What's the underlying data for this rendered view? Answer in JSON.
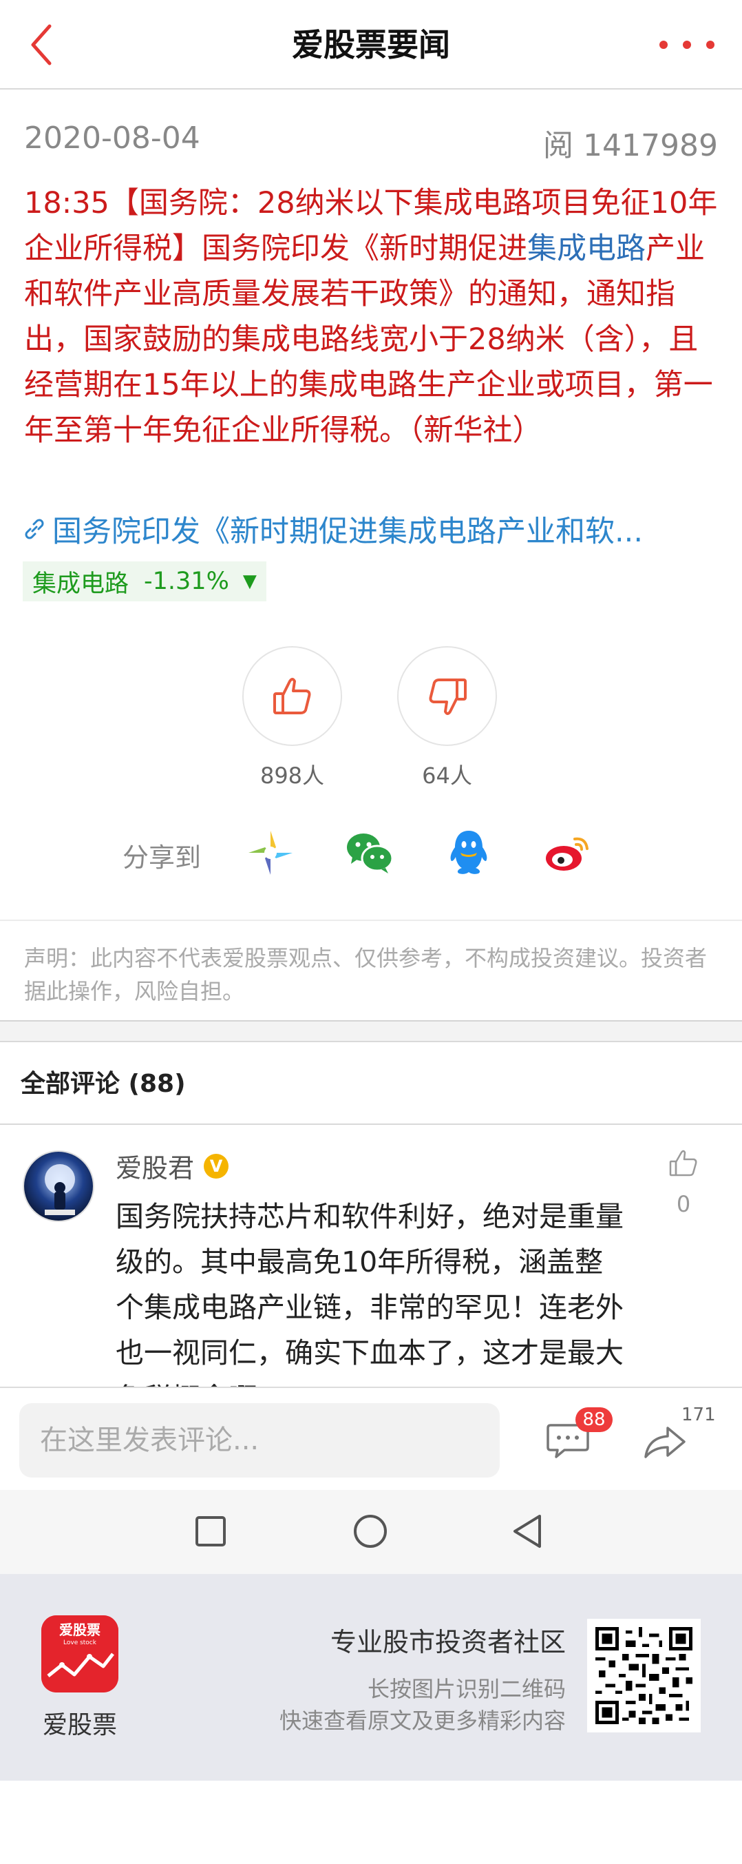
{
  "header": {
    "title": "爱股票要闻"
  },
  "meta": {
    "date": "2020-08-04",
    "reads": "阅 1417989"
  },
  "article": {
    "text_part1": "18:35【国务院：28纳米以下集成电路项目免征10年企业所得税】国务院印发《新时期促进",
    "highlight": "集成电路",
    "text_part2": "产业和软件产业高质量发展若干政策》的通知，通知指出，国家鼓励的集成电路线宽小于28纳米（含），且经营期在15年以上的集成电路生产企业或项目，第一年至第十年免征企业所得税。（新华社）"
  },
  "link": {
    "text": "国务院印发《新时期促进集成电路产业和软..."
  },
  "stock": {
    "name": "集成电路",
    "change": "-1.31%",
    "arrow": "▼",
    "color": "#1e9b1e"
  },
  "votes": {
    "up_count": "898人",
    "down_count": "64人"
  },
  "share": {
    "label": "分享到",
    "targets": [
      "moments-icon",
      "wechat-icon",
      "qq-icon",
      "weibo-icon"
    ]
  },
  "disclaimer": {
    "text": "声明：此内容不代表爱股票观点、仅供参考，不构成投资建议。投资者据此操作，风险自担。"
  },
  "comments": {
    "header": "全部评论 (88)",
    "items": [
      {
        "user": "爱股君",
        "verified": "V",
        "body": "国务院扶持芯片和软件利好，绝对是重量级的。其中最高免10年所得税，涵盖整个集成电路产业链，非常的罕见！连老外也一视同仁，确实下血本了，这才是最大免税概念啊。",
        "likes": "0"
      }
    ]
  },
  "bottom_bar": {
    "placeholder": "在这里发表评论...",
    "comment_badge": "88",
    "share_count": "171"
  },
  "promo": {
    "brand": "爱股票",
    "logo_text": "爱股票",
    "logo_sub": "Love stock",
    "tagline": "专业股市投资者社区",
    "hint1": "长按图片识别二维码",
    "hint2": "快速查看原文及更多精彩内容"
  },
  "colors": {
    "accent": "#e53935",
    "article_red": "#cc1b1b",
    "link_blue": "#2d86cc",
    "stock_green": "#1e9b1e"
  }
}
